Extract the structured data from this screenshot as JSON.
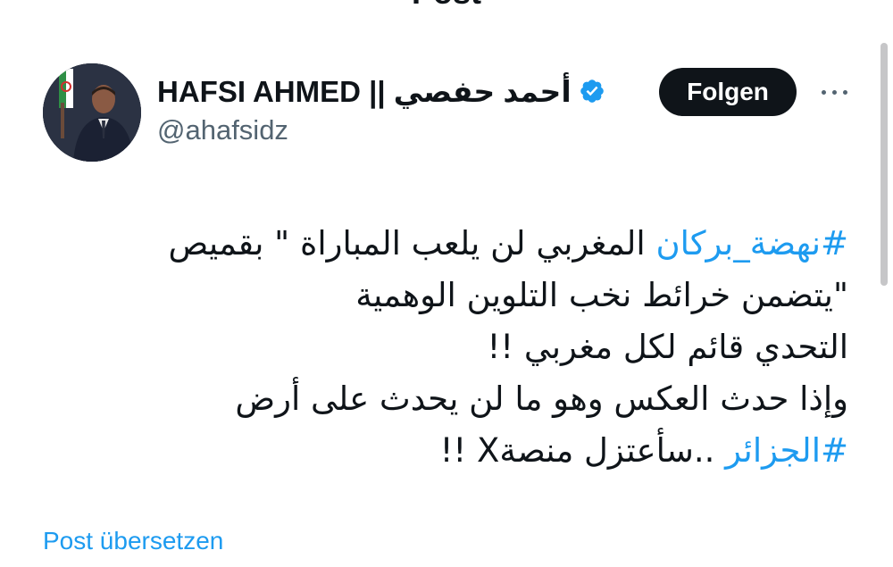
{
  "header": {
    "title": "Post",
    "back_icon": "arrow-left-icon"
  },
  "author": {
    "display_name": "HAFSI AHMED || أحمد حفصي",
    "handle": "@ahafsidz",
    "verified_icon": "verified-badge-icon",
    "verified_color": "#1d9bf0"
  },
  "actions": {
    "follow_label": "Folgen",
    "more_icon": "more-horizontal-icon"
  },
  "tweet": {
    "line1_hashtag": "#نهضة_بركان",
    "line1_text": " المغربي لن يلعب المباراة \" بقميص",
    "line2": "\"يتضمن خرائط نخب التلوين الوهمية",
    "line3": "التحدي قائم لكل مغربي !!",
    "line4": "وإذا حدث العكس وهو ما لن يحدث على أرض",
    "line5_hashtag": "#الجزائر",
    "line5_text": " ..سأعتزل منصةX !!"
  },
  "translate_label": "Post übersetzen",
  "colors": {
    "accent": "#1d9bf0",
    "text": "#0f1419",
    "secondary": "#536471",
    "button_bg": "#0f1419"
  }
}
